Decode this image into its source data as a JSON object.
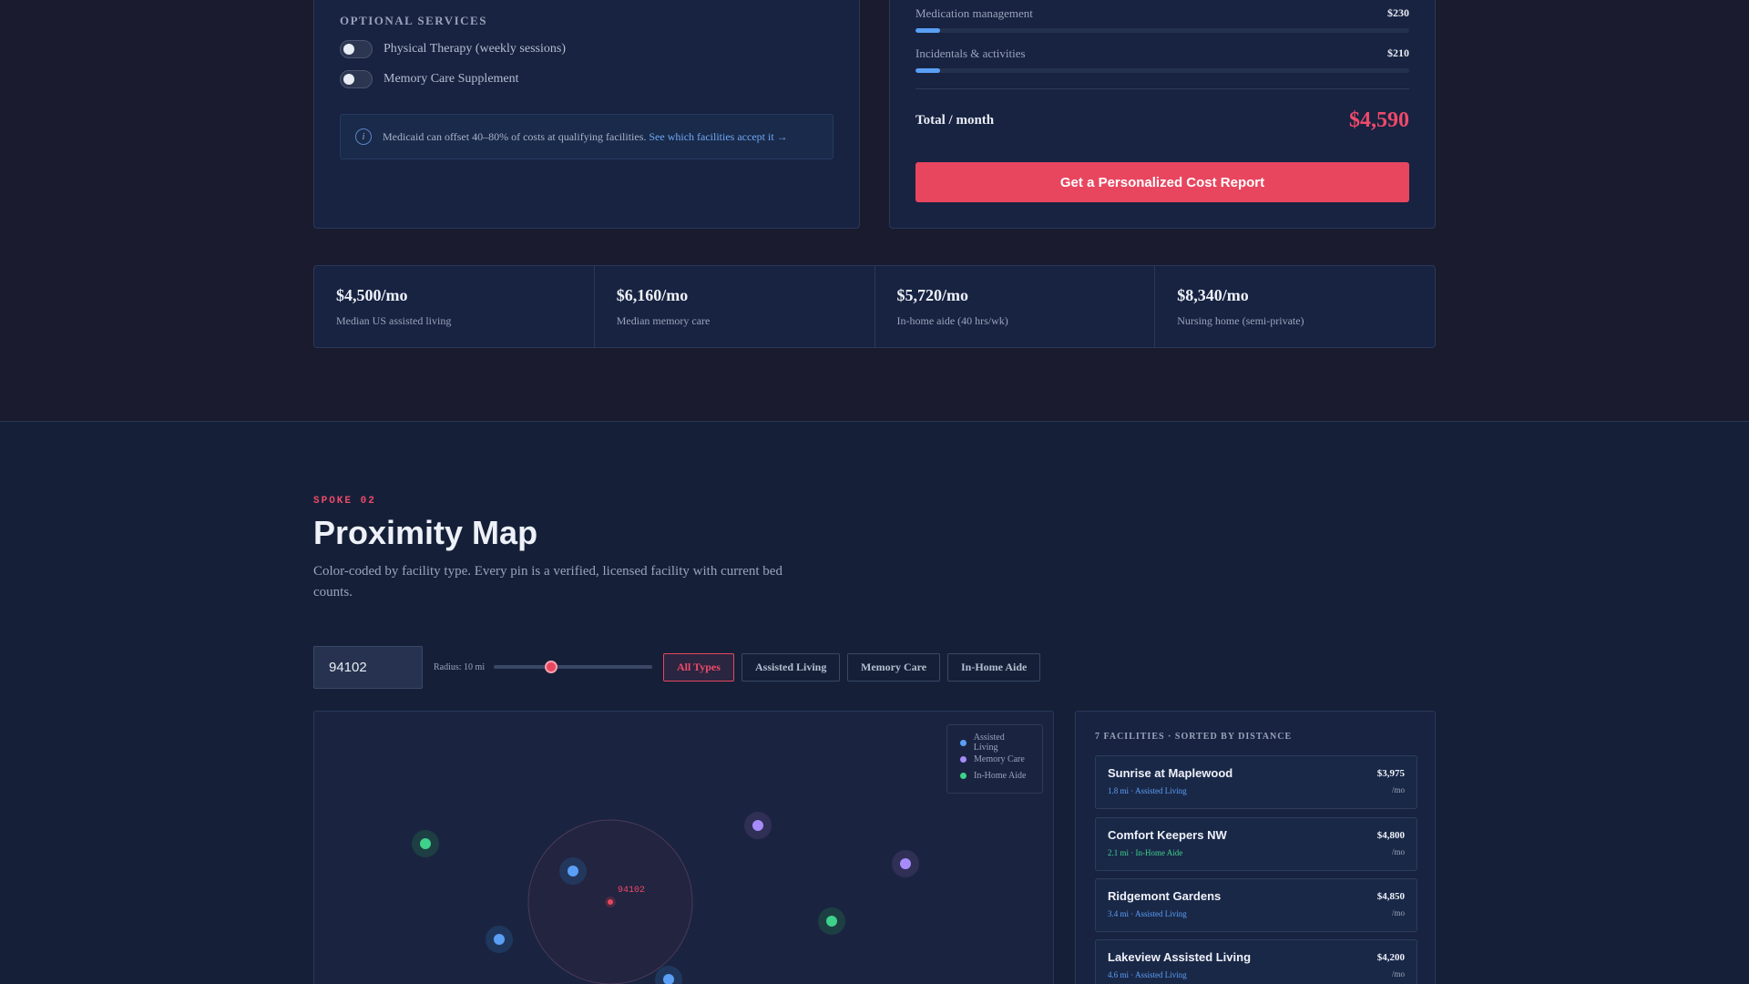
{
  "optional_services": {
    "title": "OPTIONAL SERVICES",
    "items": [
      {
        "label": "Physical Therapy (weekly sessions)",
        "enabled": false
      },
      {
        "label": "Memory Care Supplement",
        "enabled": false
      }
    ],
    "info": {
      "icon": "info-icon",
      "glyph": "i",
      "text": "Medicaid can offset 40–80% of costs at qualifying facilities.",
      "link": "See which facilities accept it →"
    }
  },
  "cost_breakdown": {
    "items": [
      {
        "label": "Medication management",
        "amount": "$230",
        "fill_fraction": 0.05
      },
      {
        "label": "Incidentals & activities",
        "amount": "$210",
        "fill_fraction": 0.05
      }
    ],
    "total_label": "Total / month",
    "total_value": "$4,590",
    "cta_label": "Get a Personalized Cost Report"
  },
  "stats": [
    {
      "value": "$4,500/mo",
      "label": "Median US assisted living"
    },
    {
      "value": "$6,160/mo",
      "label": "Median memory care"
    },
    {
      "value": "$5,720/mo",
      "label": "In-home aide (40 hrs/wk)"
    },
    {
      "value": "$8,340/mo",
      "label": "Nursing home (semi-private)"
    }
  ],
  "proximity": {
    "eyebrow": "SPOKE 02",
    "title": "Proximity Map",
    "subtitle": "Color-coded by facility type. Every pin is a verified, licensed facility with current bed counts.",
    "zip_value": "94102",
    "radius_label": "Radius: 10 mi",
    "radius_miles": 10,
    "filters": [
      "All Types",
      "Assisted Living",
      "Memory Care",
      "In-Home Aide"
    ],
    "active_filter": "All Types",
    "map_center_label": "94102",
    "legend": [
      {
        "label": "Assisted Living",
        "color": "#5a9ff5"
      },
      {
        "label": "Memory Care",
        "color": "#a78bfa"
      },
      {
        "label": "In-Home Aide",
        "color": "#3ed18a"
      }
    ],
    "list_header": "7 FACILITIES · SORTED BY DISTANCE",
    "facilities": [
      {
        "name": "Sunrise at Maplewood",
        "meta": "1.8 mi · Assisted Living",
        "type_color": "#5a9ff5",
        "price": "$3,975",
        "per": "/mo"
      },
      {
        "name": "Comfort Keepers NW",
        "meta": "2.1 mi · In-Home Aide",
        "type_color": "#3ed18a",
        "price": "$4,800",
        "per": "/mo"
      },
      {
        "name": "Ridgemont Gardens",
        "meta": "3.4 mi · Assisted Living",
        "type_color": "#5a9ff5",
        "price": "$4,850",
        "per": "/mo"
      },
      {
        "name": "Lakeview Assisted Living",
        "meta": "4.6 mi · Assisted Living",
        "type_color": "#5a9ff5",
        "price": "$4,200",
        "per": "/mo"
      }
    ]
  }
}
